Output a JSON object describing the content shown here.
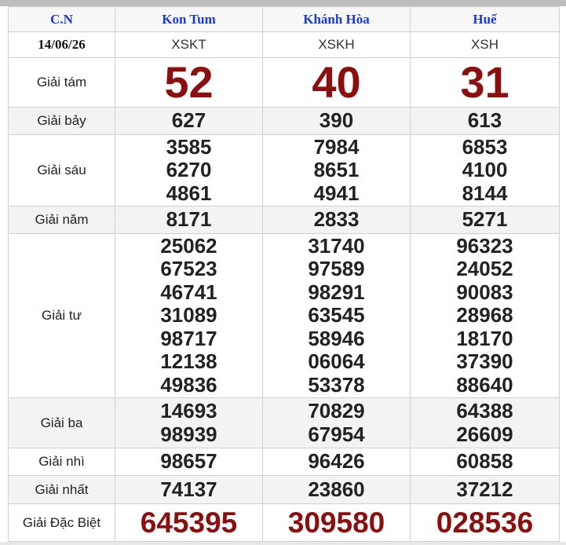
{
  "header": {
    "col_label": "C.N",
    "provinces": [
      "Kon Tum",
      "Khánh Hòa",
      "Huế"
    ],
    "date": "14/06/26",
    "codes": [
      "XSKT",
      "XSKH",
      "XSH"
    ]
  },
  "prizes": {
    "g8": {
      "label": "Giải tám",
      "values": [
        [
          "52"
        ],
        [
          "40"
        ],
        [
          "31"
        ]
      ]
    },
    "g7": {
      "label": "Giải bảy",
      "values": [
        [
          "627"
        ],
        [
          "390"
        ],
        [
          "613"
        ]
      ]
    },
    "g6": {
      "label": "Giải sáu",
      "values": [
        [
          "3585",
          "6270",
          "4861"
        ],
        [
          "7984",
          "8651",
          "4941"
        ],
        [
          "6853",
          "4100",
          "8144"
        ]
      ]
    },
    "g5": {
      "label": "Giải năm",
      "values": [
        [
          "8171"
        ],
        [
          "2833"
        ],
        [
          "5271"
        ]
      ]
    },
    "g4": {
      "label": "Giải tư",
      "values": [
        [
          "25062",
          "67523",
          "46741",
          "31089",
          "98717",
          "12138",
          "49836"
        ],
        [
          "31740",
          "97589",
          "98291",
          "63545",
          "58946",
          "06064",
          "53378"
        ],
        [
          "96323",
          "24052",
          "90083",
          "28968",
          "18170",
          "37390",
          "88640"
        ]
      ]
    },
    "g3": {
      "label": "Giải ba",
      "values": [
        [
          "14693",
          "98939"
        ],
        [
          "70829",
          "67954"
        ],
        [
          "64388",
          "26609"
        ]
      ]
    },
    "g2": {
      "label": "Giải nhì",
      "values": [
        [
          "98657"
        ],
        [
          "96426"
        ],
        [
          "60858"
        ]
      ]
    },
    "g1": {
      "label": "Giải nhất",
      "values": [
        [
          "74137"
        ],
        [
          "23860"
        ],
        [
          "37212"
        ]
      ]
    },
    "db": {
      "label": "Giải Đặc Biệt",
      "values": [
        [
          "645395"
        ],
        [
          "309580"
        ],
        [
          "028536"
        ]
      ]
    }
  },
  "colors": {
    "province_text": "#1a3ccc",
    "highlight_number": "#8b0f0f",
    "row_alt_bg": "#f3f3f3"
  }
}
